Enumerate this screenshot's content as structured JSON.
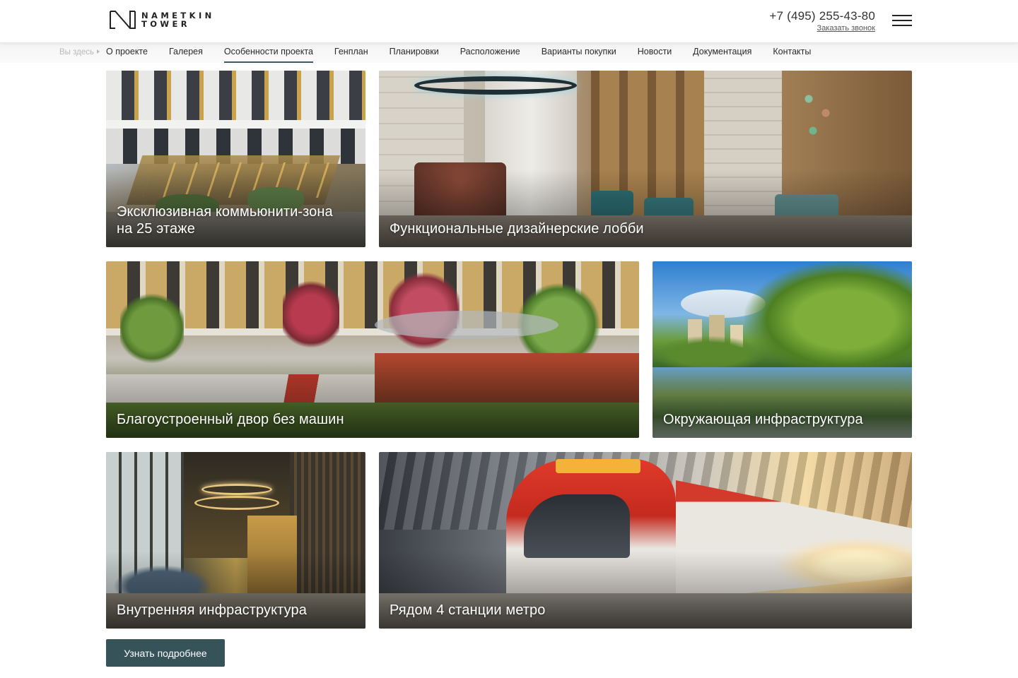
{
  "brand": {
    "line1": "NAMETKIN",
    "line2": "TOWER"
  },
  "header": {
    "phone": "+7 (495) 255-43-80",
    "callback_label": "Заказать звонок"
  },
  "breadcrumb": {
    "label": "Вы здесь"
  },
  "nav": {
    "items": [
      {
        "label": "О проекте",
        "active": false
      },
      {
        "label": "Галерея",
        "active": false
      },
      {
        "label": "Особенности проекта",
        "active": true
      },
      {
        "label": "Генплан",
        "active": false
      },
      {
        "label": "Планировки",
        "active": false
      },
      {
        "label": "Расположение",
        "active": false
      },
      {
        "label": "Варианты покупки",
        "active": false
      },
      {
        "label": "Новости",
        "active": false
      },
      {
        "label": "Документация",
        "active": false
      },
      {
        "label": "Контакты",
        "active": false
      }
    ]
  },
  "tiles": [
    {
      "line1": "Эксклюзивная коммьюнити-зона",
      "line2": "на 25 этаже",
      "image": "rooftop-terrace"
    },
    {
      "line1": "Функциональные дизайнерские лобби",
      "line2": "",
      "image": "lobby-interior"
    },
    {
      "line1": "Благоустроенный двор без машин",
      "line2": "",
      "image": "courtyard-park"
    },
    {
      "line1": "Окружающая инфраструктура",
      "line2": "",
      "image": "lake-park"
    },
    {
      "line1": "Внутренняя инфраструктура",
      "line2": "",
      "image": "lounge-interior"
    },
    {
      "line1": "Рядом 4 станции метро",
      "line2": "",
      "image": "metro-train"
    }
  ],
  "cta": {
    "label": "Узнать подробнее"
  },
  "colors": {
    "accent": "#36535a",
    "nav_underline": "#3d5a60"
  }
}
